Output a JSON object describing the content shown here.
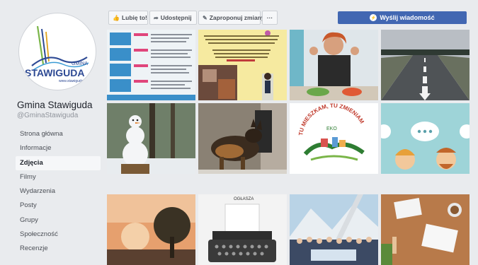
{
  "page": {
    "name": "Gmina Stawiguda",
    "handle": "@GminaStawiguda",
    "logo_top": "GMINA",
    "logo_main": "STAWIGUDA",
    "logo_url": "www.stawiguda"
  },
  "nav": {
    "items": [
      "Strona główna",
      "Informacje",
      "Zdjęcia",
      "Filmy",
      "Wydarzenia",
      "Posty",
      "Grupy",
      "Społeczność",
      "Recenzje"
    ],
    "active": "Zdjęcia"
  },
  "actions": {
    "like": "Lubię to!",
    "share": "Udostępnij",
    "suggest": "Zaproponuj zmiany",
    "more": "···",
    "message": "Wyślij wiadomość"
  },
  "photos": {
    "eko_line1": "TU MIESZKAM, TU ZMIENIAM",
    "eko_line2": "EKO",
    "notice_label": "OGŁASZA"
  },
  "colors": {
    "brand_blue": "#4267b2",
    "page_bg": "#e9ebee"
  }
}
